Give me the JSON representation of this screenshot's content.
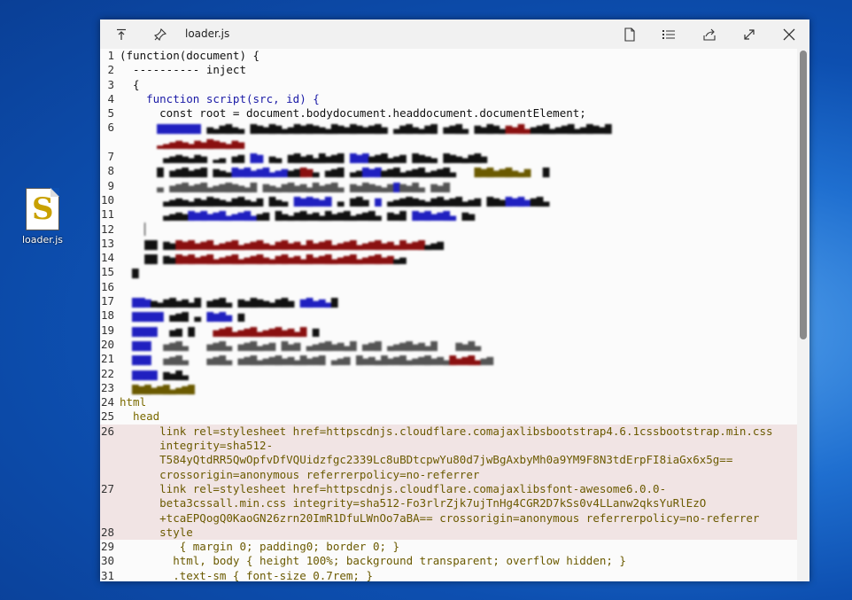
{
  "desktop": {
    "icon_label": "loader.js"
  },
  "window": {
    "title": "loader.js"
  },
  "code_lines": [
    {
      "n": "1",
      "t": "(function(document) {"
    },
    {
      "n": "2",
      "t": "  ---------- inject"
    },
    {
      "n": "3",
      "t": "  {"
    },
    {
      "n": "4",
      "t": "    function script(src, id) {"
    },
    {
      "n": "5",
      "t": "      const root = document.bodydocument.headdocument.documentElement;"
    },
    {
      "n": "26",
      "t": "      link rel=stylesheet href=httpscdnjs.cloudflare.comajaxlibsbootstrap4.6.1cssbootstrap.min.css"
    },
    {
      "n": "26b",
      "t": "      integrity=sha512-"
    },
    {
      "n": "26c",
      "t": "      T584yQtdRR5QwOpfvDfVQUidzfgc2339Lc8uBDtcpwYu80d7jwBgAxbyMh0a9YM9F8N3tdErpFI8iaGx6x5g=="
    },
    {
      "n": "26d",
      "t": "      crossorigin=anonymous referrerpolicy=no-referrer"
    },
    {
      "n": "27",
      "t": "      link rel=stylesheet href=httpscdnjs.cloudflare.comajaxlibsfont-awesome6.0.0-"
    },
    {
      "n": "27b",
      "t": "      beta3cssall.min.css integrity=sha512-Fo3rlrZjk7ujTnHg4CGR2D7kSs0v4LLanw2qksYuRlEzO"
    },
    {
      "n": "27c",
      "t": "      +tcaEPQogQ0KaoGN26zrn20ImR1DfuLWnOo7aBA== crossorigin=anonymous referrerpolicy=no-referrer"
    },
    {
      "n": "28",
      "t": "      style"
    },
    {
      "n": "29",
      "t": "         { margin 0; padding0; border 0; }"
    },
    {
      "n": "30",
      "t": "        html, body { height 100%; background transparent; overflow hidden; }"
    },
    {
      "n": "31",
      "t": "        .text-sm { font-size 0.7rem; }"
    }
  ],
  "html_lines": {
    "l24": "html",
    "l25": "  head"
  }
}
